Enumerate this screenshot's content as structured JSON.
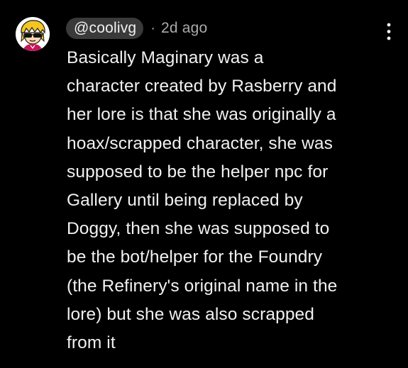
{
  "comment": {
    "author": "@coolivg",
    "separator": "·",
    "timestamp": "2d ago",
    "lines": [
      "Basically Maginary was a",
      "character created by Rasberry and",
      "her lore is that she was originally a",
      "hoax/scrapped character, she was",
      "supposed to be the helper npc for",
      "Gallery until being replaced by",
      "Doggy, then she was supposed to",
      "be the bot/helper for the Foundry",
      "(the Refinery's original name in the",
      "lore) but she was also scrapped",
      "from it"
    ],
    "avatar_icon": "cartoon-character-avatar-icon",
    "menu_icon": "more-vertical-icon"
  },
  "colors": {
    "background": "#000000",
    "text": "#f1f1f1",
    "secondary_text": "#aaaaaa",
    "handle_chip": "#3a3a3a"
  }
}
